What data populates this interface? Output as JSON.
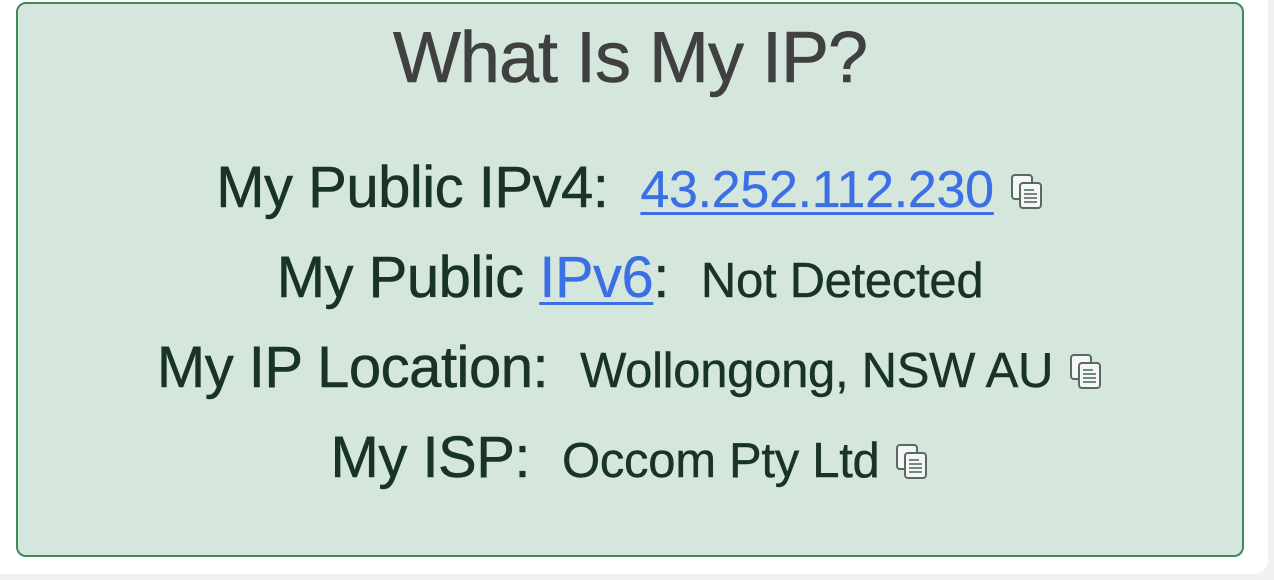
{
  "title": "What Is My IP?",
  "ipv4": {
    "label": "My Public IPv4:",
    "value": "43.252.112.230"
  },
  "ipv6": {
    "label_prefix": "My Public ",
    "label_link": "IPv6",
    "label_suffix": ":",
    "value": "Not Detected"
  },
  "location": {
    "label": "My IP Location:",
    "value": "Wollongong, NSW AU"
  },
  "isp": {
    "label": "My ISP:",
    "value": "Occom Pty Ltd"
  },
  "icons": {
    "copy": "copy-to-clipboard-icon"
  },
  "colors": {
    "card_background": "#d5e6dd",
    "card_border": "#3f8a56",
    "text": "#183422",
    "title": "#404040",
    "link": "#3a6fe6"
  }
}
